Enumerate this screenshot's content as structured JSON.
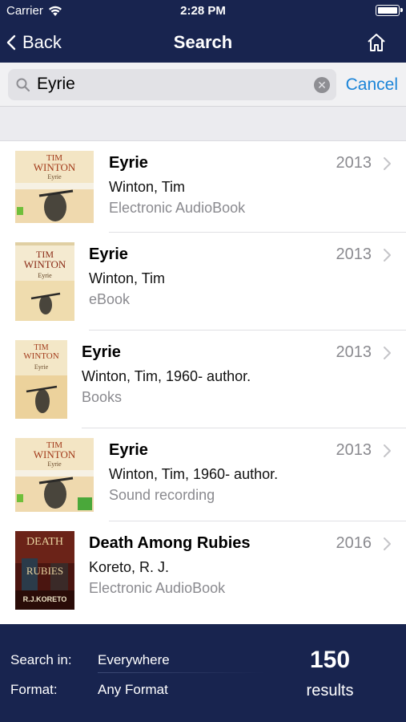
{
  "status_bar": {
    "carrier": "Carrier",
    "time": "2:28 PM"
  },
  "nav": {
    "back_label": "Back",
    "title": "Search"
  },
  "search": {
    "query": "Eyrie",
    "cancel_label": "Cancel"
  },
  "results": [
    {
      "title": "Eyrie",
      "author": "Winton, Tim",
      "format": "Electronic AudioBook",
      "year": "2013",
      "cover": {
        "author_text": "TIM",
        "author_text2": "WINTON",
        "book_text": "Eyrie"
      }
    },
    {
      "title": "Eyrie",
      "author": "Winton, Tim",
      "format": "eBook",
      "year": "2013",
      "cover": {
        "author_text": "TIM",
        "author_text2": "WINTON",
        "book_text": "Eyrie"
      }
    },
    {
      "title": "Eyrie",
      "author": "Winton, Tim, 1960- author.",
      "format": "Books",
      "year": "2013",
      "cover": {
        "author_text": "TIM",
        "author_text2": "WINTON",
        "book_text": "Eyrie"
      }
    },
    {
      "title": "Eyrie",
      "author": "Winton, Tim, 1960- author.",
      "format": "Sound recording",
      "year": "2013",
      "cover": {
        "author_text": "TIM",
        "author_text2": "WINTON",
        "book_text": "Eyrie"
      }
    },
    {
      "title": "Death Among Rubies",
      "author": "Koreto, R. J.",
      "format": "Electronic AudioBook",
      "year": "2016",
      "cover": {
        "author_text": "R.J.KORETO",
        "book_text": "DEATH",
        "book_text2": "RUBIES"
      }
    }
  ],
  "footer": {
    "search_in_label": "Search in:",
    "search_in_value": "Everywhere",
    "format_label": "Format:",
    "format_value": "Any Format",
    "count": "150",
    "count_label": "results"
  },
  "colors": {
    "nav_bg": "#18244f",
    "accent": "#1a84d8",
    "secondary_text": "#8a8a8f"
  }
}
